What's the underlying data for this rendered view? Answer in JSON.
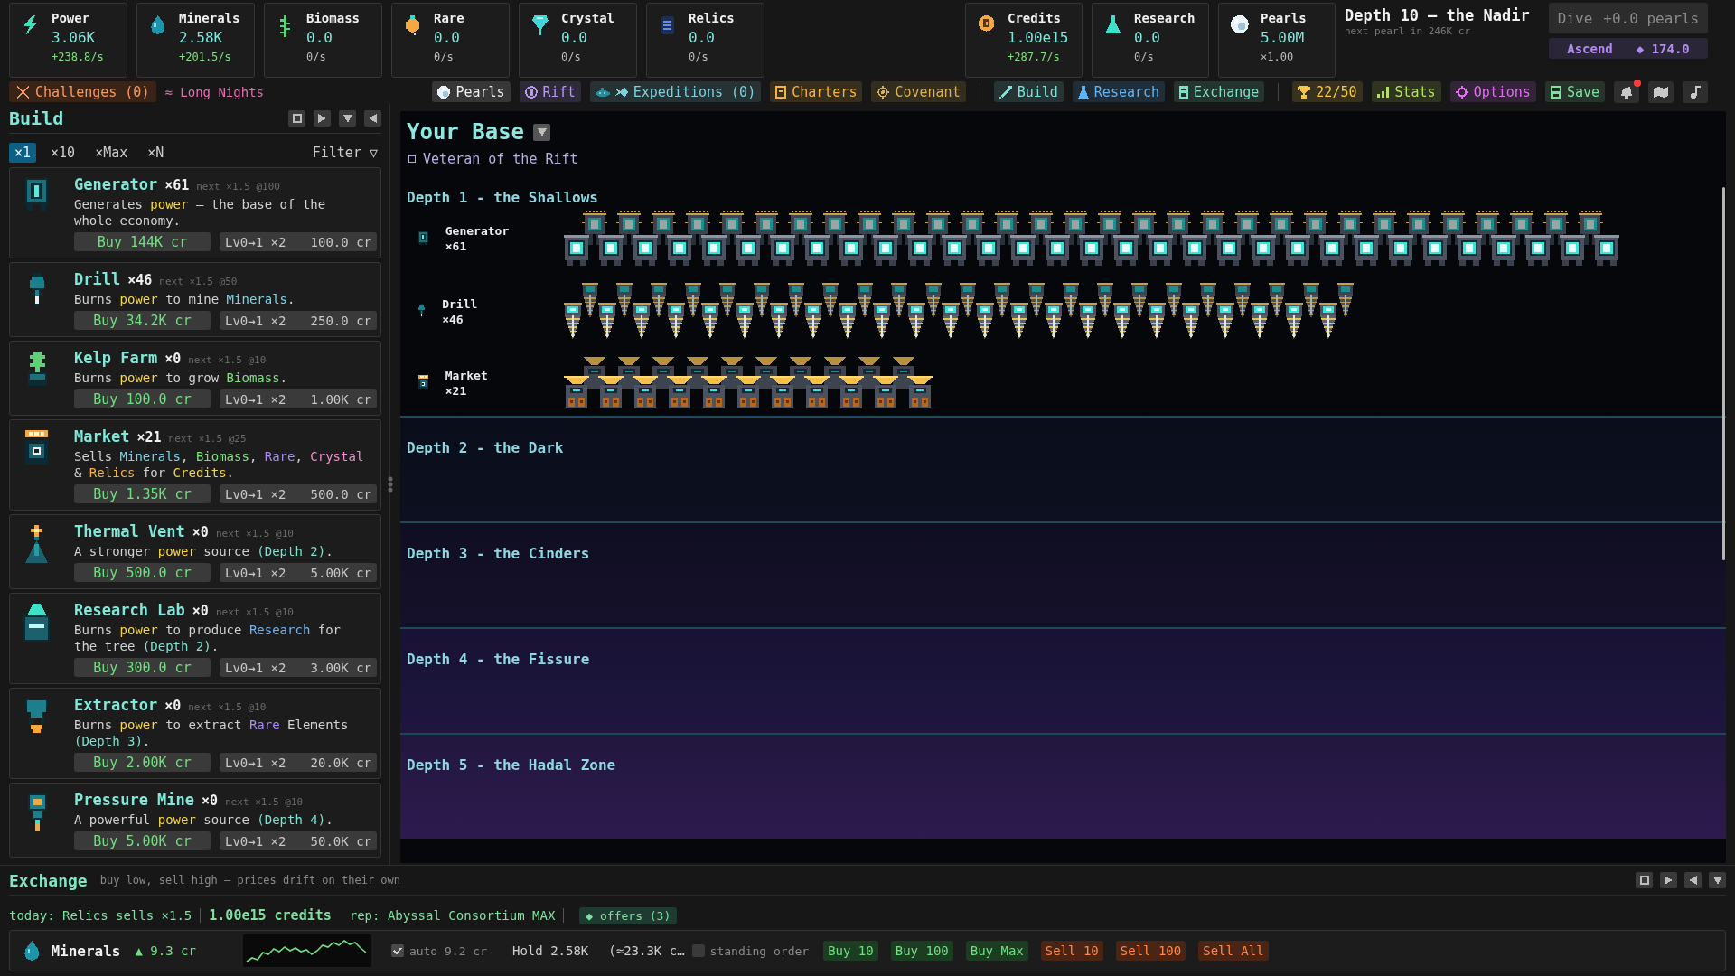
{
  "resources": [
    {
      "kind": "power",
      "name": "Power",
      "value": "3.06K",
      "rate": "+238.8/s",
      "rising": true
    },
    {
      "kind": "minerals",
      "name": "Minerals",
      "value": "2.58K",
      "rate": "+201.5/s",
      "rising": true
    },
    {
      "kind": "biomass",
      "name": "Biomass",
      "value": "0.0",
      "rate": "0/s",
      "rising": false
    },
    {
      "kind": "rare",
      "name": "Rare",
      "value": "0.0",
      "rate": "0/s",
      "rising": false
    },
    {
      "kind": "crystal",
      "name": "Crystal",
      "value": "0.0",
      "rate": "0/s",
      "rising": false
    },
    {
      "kind": "relics",
      "name": "Relics",
      "value": "0.0",
      "rate": "0/s",
      "rising": false
    }
  ],
  "currencies": [
    {
      "kind": "credits",
      "name": "Credits",
      "value": "1.00e15",
      "rate": "+287.7/s",
      "rising": true
    },
    {
      "kind": "research",
      "name": "Research",
      "value": "0.0",
      "rate": "0/s",
      "rising": false
    },
    {
      "kind": "pearls",
      "name": "Pearls",
      "value": "5.00M",
      "rate": "×1.00",
      "rising": false
    }
  ],
  "depth": {
    "title": "Depth 10 — the Nadir",
    "note": "next pearl in 246K cr"
  },
  "dive": {
    "label": "Dive",
    "gain": "+0.0 pearls",
    "disabled": true
  },
  "ascend": {
    "label": "Ascend",
    "cost": "◆ 174.0"
  },
  "challenges": "Challenges (0)",
  "modifier": "≈ Long Nights",
  "nav_groups": [
    {
      "items": [
        {
          "kind": "pearls",
          "label": "Pearls",
          "color": "#f0f0f0"
        },
        {
          "kind": "rift",
          "label": "Rift",
          "color": "#b89af5"
        },
        {
          "kind": "expeditions",
          "label": "Expeditions (0)",
          "color": "#7fd0dc"
        },
        {
          "kind": "charters",
          "label": "Charters",
          "color": "#f5b342"
        },
        {
          "kind": "covenant",
          "label": "Covenant",
          "color": "#d8b25a"
        }
      ]
    },
    {
      "items": [
        {
          "kind": "build",
          "label": "Build",
          "color": "#7fe0d8"
        },
        {
          "kind": "research",
          "label": "Research",
          "color": "#5fb4f5"
        },
        {
          "kind": "exchange",
          "label": "Exchange",
          "color": "#7fe0c4"
        }
      ]
    },
    {
      "items": [
        {
          "kind": "trophy",
          "label": "22/50",
          "color": "#f5c842"
        },
        {
          "kind": "stats",
          "label": "Stats",
          "color": "#b4e060"
        },
        {
          "kind": "options",
          "label": "Options",
          "color": "#e070f0"
        },
        {
          "kind": "save",
          "label": "Save",
          "color": "#7fe0a0"
        }
      ]
    }
  ],
  "tools": [
    {
      "kind": "bell",
      "alert": true
    },
    {
      "kind": "map",
      "alert": false
    },
    {
      "kind": "note",
      "alert": false
    }
  ],
  "build": {
    "title": "Build",
    "multipliers": [
      {
        "label": "×1",
        "selected": true
      },
      {
        "label": "×10",
        "selected": false
      },
      {
        "label": "×Max",
        "selected": false
      },
      {
        "label": "×N",
        "selected": false
      }
    ],
    "filter": "Filter ▽",
    "items": [
      {
        "kind": "generator",
        "name": "Generator",
        "count": "×61",
        "next": "next ×1.5 @100",
        "description": [
          {
            "text": "Generates "
          },
          {
            "text": "power",
            "color": "#f5d547"
          },
          {
            "text": " — the base of the whole economy."
          }
        ],
        "buy": "Buy 144K cr",
        "upgrade": "Lv0→1 ×2",
        "upgrade_cost": "100.0 cr"
      },
      {
        "kind": "drill",
        "name": "Drill",
        "count": "×46",
        "next": "next ×1.5 @50",
        "description": [
          {
            "text": "Burns "
          },
          {
            "text": "power",
            "color": "#f5d547"
          },
          {
            "text": " to mine "
          },
          {
            "text": "Minerals",
            "color": "#6fd8f0"
          },
          {
            "text": "."
          }
        ],
        "buy": "Buy 34.2K cr",
        "upgrade": "Lv0→1 ×2",
        "upgrade_cost": "250.0 cr"
      },
      {
        "kind": "kelp",
        "name": "Kelp Farm",
        "count": "×0",
        "next": "next ×1.5 @10",
        "description": [
          {
            "text": "Burns "
          },
          {
            "text": "power",
            "color": "#f5d547"
          },
          {
            "text": " to grow "
          },
          {
            "text": "Biomass",
            "color": "#7fe07f"
          },
          {
            "text": "."
          }
        ],
        "buy": "Buy 100.0 cr",
        "upgrade": "Lv0→1 ×2",
        "upgrade_cost": "1.00K cr"
      },
      {
        "kind": "market",
        "name": "Market",
        "count": "×21",
        "next": "next ×1.5 @25",
        "description": [
          {
            "text": "Sells "
          },
          {
            "text": "Minerals",
            "color": "#6fd8f0"
          },
          {
            "text": ", "
          },
          {
            "text": "Biomass",
            "color": "#7fe07f"
          },
          {
            "text": ", "
          },
          {
            "text": "Rare",
            "color": "#a98cf5"
          },
          {
            "text": ", "
          },
          {
            "text": "Crystal",
            "color": "#f08ccf"
          },
          {
            "text": " & "
          },
          {
            "text": "Relics",
            "color": "#f5b342"
          },
          {
            "text": " for "
          },
          {
            "text": "Credits",
            "color": "#f5d547"
          },
          {
            "text": "."
          }
        ],
        "buy": "Buy 1.35K cr",
        "upgrade": "Lv0→1 ×2",
        "upgrade_cost": "500.0 cr"
      },
      {
        "kind": "vent",
        "name": "Thermal Vent",
        "count": "×0",
        "next": "next ×1.5 @10",
        "description": [
          {
            "text": "A stronger "
          },
          {
            "text": "power",
            "color": "#f5d547"
          },
          {
            "text": " source "
          },
          {
            "text": "(Depth 2)",
            "color": "#7fe0d0"
          },
          {
            "text": "."
          }
        ],
        "buy": "Buy 500.0 cr",
        "upgrade": "Lv0→1 ×2",
        "upgrade_cost": "5.00K cr"
      },
      {
        "kind": "lab",
        "name": "Research Lab",
        "count": "×0",
        "next": "next ×1.5 @10",
        "description": [
          {
            "text": "Burns "
          },
          {
            "text": "power",
            "color": "#f5d547"
          },
          {
            "text": " to produce "
          },
          {
            "text": "Research",
            "color": "#6fb4f5"
          },
          {
            "text": " for the tree "
          },
          {
            "text": "(Depth 2)",
            "color": "#7fe0d0"
          },
          {
            "text": "."
          }
        ],
        "buy": "Buy 300.0 cr",
        "upgrade": "Lv0→1 ×2",
        "upgrade_cost": "3.00K cr"
      },
      {
        "kind": "extractor",
        "name": "Extractor",
        "count": "×0",
        "next": "next ×1.5 @10",
        "description": [
          {
            "text": "Burns "
          },
          {
            "text": "power",
            "color": "#f5d547"
          },
          {
            "text": " to extract "
          },
          {
            "text": "Rare",
            "color": "#a98cf5"
          },
          {
            "text": " Elements "
          },
          {
            "text": "(Depth 3)",
            "color": "#7fe0d0"
          },
          {
            "text": "."
          }
        ],
        "buy": "Buy 2.00K cr",
        "upgrade": "Lv0→1 ×2",
        "upgrade_cost": "20.0K cr"
      },
      {
        "kind": "mine",
        "name": "Pressure Mine",
        "count": "×0",
        "next": "next ×1.5 @10",
        "description": [
          {
            "text": "A powerful "
          },
          {
            "text": "power",
            "color": "#f5d547"
          },
          {
            "text": " source "
          },
          {
            "text": "(Depth 4)",
            "color": "#7fe0d0"
          },
          {
            "text": "."
          }
        ],
        "buy": "Buy 5.00K cr",
        "upgrade": "Lv0→1 ×2",
        "upgrade_cost": "50.0K cr"
      }
    ]
  },
  "base": {
    "title": "Your Base",
    "badge": "Veteran of the Rift",
    "depths": [
      {
        "title": "Depth 1 - the Shallows",
        "buildings": [
          {
            "kind": "generator",
            "name": "Generator",
            "count": "×61"
          },
          {
            "kind": "drill",
            "name": "Drill",
            "count": "×46"
          },
          {
            "kind": "market",
            "name": "Market",
            "count": "×21"
          }
        ]
      },
      {
        "title": "Depth 2 - the Dark"
      },
      {
        "title": "Depth 3 - the Cinders"
      },
      {
        "title": "Depth 4 - the Fissure"
      },
      {
        "title": "Depth 5 - the Hadal Zone"
      }
    ]
  },
  "exchange": {
    "title": "Exchange",
    "subtitle": "buy low, sell high — prices drift on their own",
    "today": "today: Relics sells ×1.5",
    "credits": "1.00e15 credits",
    "rep": "rep: Abyssal Consortium MAX",
    "offers": "◆ offers (3)",
    "market": {
      "kind": "minerals",
      "name": "Minerals",
      "price": "▲ 9.3 cr",
      "auto": {
        "label": "auto 9.2 cr",
        "checked": true
      },
      "hold": "Hold 2.58K",
      "worth": "(≈23.3K c…",
      "standing": {
        "label": "standing order",
        "checked": false
      },
      "trades": [
        {
          "kind": "buy",
          "label": "Buy 10"
        },
        {
          "kind": "buy",
          "label": "Buy 100"
        },
        {
          "kind": "buy",
          "label": "Buy Max"
        },
        {
          "kind": "sell",
          "label": "Sell 10"
        },
        {
          "kind": "sell",
          "label": "Sell 100"
        },
        {
          "kind": "sell",
          "label": "Sell All"
        }
      ]
    }
  }
}
